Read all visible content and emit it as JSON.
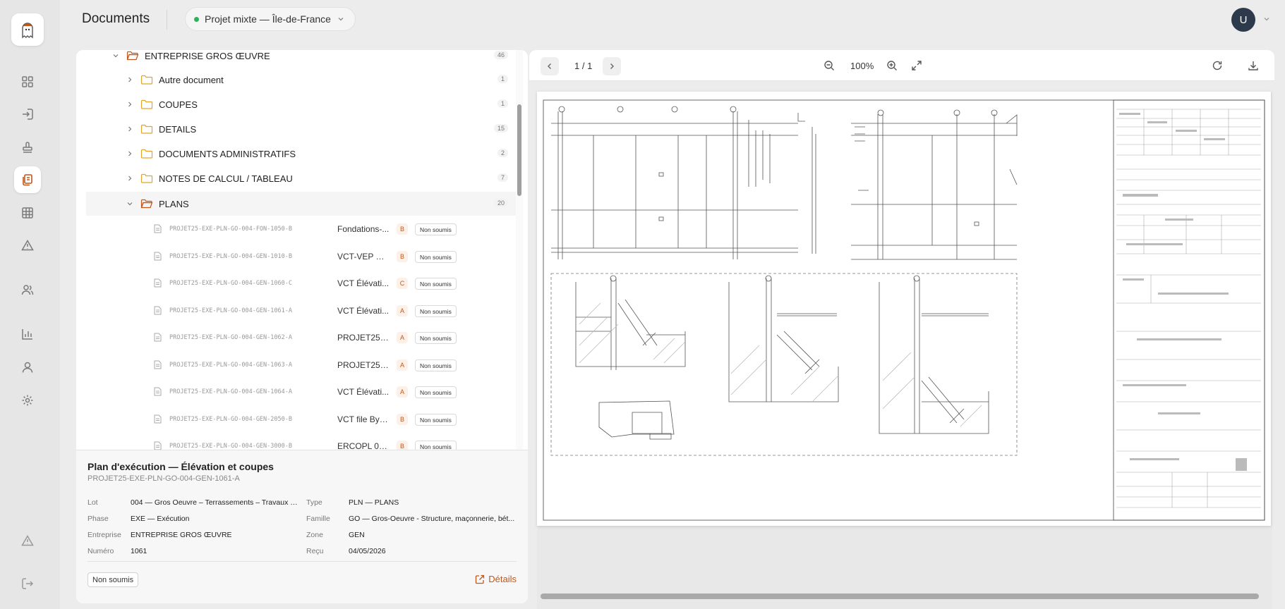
{
  "header": {
    "title": "Documents",
    "project": "Projet mixte — Île-de-France",
    "avatar_initial": "U"
  },
  "colors": {
    "accent": "#c2571a",
    "project_dot": "#2bb35a",
    "avatar_bg": "#2d3a4b"
  },
  "sidebar": {
    "icons": [
      "dashboard-icon",
      "import-icon",
      "stamp-icon",
      "documents-icon",
      "grid-icon",
      "alert-icon",
      "users-icon",
      "chart-icon",
      "user-icon",
      "settings-icon",
      "warning-icon",
      "logout-icon"
    ],
    "active": "documents-icon"
  },
  "tree": {
    "root": {
      "label": "ENTREPRISE GROS ŒUVRE",
      "count": "46"
    },
    "folders": [
      {
        "label": "Autre document",
        "count": "1"
      },
      {
        "label": "COUPES",
        "count": "1"
      },
      {
        "label": "DETAILS",
        "count": "15"
      },
      {
        "label": "DOCUMENTS ADMINISTRATIFS",
        "count": "2"
      },
      {
        "label": "NOTES DE CALCUL / TABLEAU",
        "count": "7"
      }
    ],
    "open_folder": {
      "label": "PLANS",
      "count": "20"
    },
    "documents": [
      {
        "ref": "PROJET25-EXE-PLN-GO-004-FON-1050-B",
        "title": "Fondations-...",
        "index": "B",
        "status": "Non soumis"
      },
      {
        "ref": "PROJET25-EXE-PLN-GO-004-GEN-1010-B",
        "title": "VCT-VEP Bu...",
        "index": "B",
        "status": "Non soumis"
      },
      {
        "ref": "PROJET25-EXE-PLN-GO-004-GEN-1060-C",
        "title": "VCT Élévati...",
        "index": "C",
        "status": "Non soumis"
      },
      {
        "ref": "PROJET25-EXE-PLN-GO-004-GEN-1061-A",
        "title": "VCT Élévati...",
        "index": "A",
        "status": "Non soumis"
      },
      {
        "ref": "PROJET25-EXE-PLN-GO-004-GEN-1062-A",
        "title": "PROJET25-E...",
        "index": "A",
        "status": "Non soumis"
      },
      {
        "ref": "PROJET25-EXE-PLN-GO-004-GEN-1063-A",
        "title": "PROJET25-E...",
        "index": "A",
        "status": "Non soumis"
      },
      {
        "ref": "PROJET25-EXE-PLN-GO-004-GEN-1064-A",
        "title": "VCT Élévati...",
        "index": "A",
        "status": "Non soumis"
      },
      {
        "ref": "PROJET25-EXE-PLN-GO-004-GEN-2050-B",
        "title": "VCT file By -...",
        "index": "B",
        "status": "Non soumis"
      },
      {
        "ref": "PROJET25-EXE-PLN-GO-004-GEN-3000-B",
        "title": "ERCOPL 01 V...",
        "index": "B",
        "status": "Non soumis"
      }
    ]
  },
  "details": {
    "title": "Plan d'exécution — Élévation et coupes",
    "ref": "PROJET25-EXE-PLN-GO-004-GEN-1061-A",
    "left": [
      {
        "k": "Lot",
        "v": "004 — Gros Oeuvre – Terrassements – Travaux s..."
      },
      {
        "k": "Phase",
        "v": "EXE — Exécution"
      },
      {
        "k": "Entreprise",
        "v": "ENTREPRISE GROS ŒUVRE"
      },
      {
        "k": "Numéro",
        "v": "1061"
      }
    ],
    "right": [
      {
        "k": "Type",
        "v": "PLN — PLANS"
      },
      {
        "k": "Famille",
        "v": "GO — Gros-Oeuvre - Structure, maçonnerie, bét..."
      },
      {
        "k": "Zone",
        "v": "GEN"
      },
      {
        "k": "Reçu",
        "v": "04/05/2026"
      }
    ],
    "status": "Non soumis",
    "link": "Détails"
  },
  "viewer": {
    "page": "1 / 1",
    "zoom": "100%"
  }
}
